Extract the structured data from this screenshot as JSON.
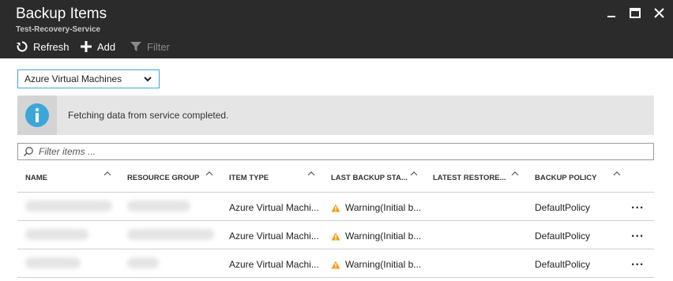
{
  "header": {
    "title": "Backup Items",
    "subtitle": "Test-Recovery-Service"
  },
  "toolbar": {
    "refresh_label": "Refresh",
    "add_label": "Add",
    "filter_label": "Filter"
  },
  "dropdown": {
    "selected": "Azure Virtual Machines"
  },
  "info_banner": {
    "message": "Fetching data from service completed."
  },
  "filter": {
    "placeholder": "Filter items ..."
  },
  "table": {
    "columns": [
      "NAME",
      "RESOURCE GROUP",
      "ITEM TYPE",
      "LAST BACKUP STA...",
      "LATEST RESTORE...",
      "BACKUP POLICY"
    ],
    "rows": [
      {
        "item_type": "Azure Virtual Machi...",
        "status": "Warning(Initial b...",
        "policy": "DefaultPolicy",
        "more": "..."
      },
      {
        "item_type": "Azure Virtual Machi...",
        "status": "Warning(Initial b...",
        "policy": "DefaultPolicy",
        "more": "..."
      },
      {
        "item_type": "Azure Virtual Machi...",
        "status": "Warning(Initial b...",
        "policy": "DefaultPolicy",
        "more": "..."
      }
    ]
  },
  "icons": {
    "refresh": "refresh-icon",
    "add": "plus-icon",
    "filter": "funnel-icon",
    "info": "info-icon",
    "search": "search-icon",
    "warning": "warning-icon",
    "sort": "chevron-up-icon"
  },
  "colors": {
    "header_bg": "#2b2b2b",
    "accent": "#3ca6d9",
    "info": "#3ca6d9",
    "warning": "#f29d1a"
  }
}
